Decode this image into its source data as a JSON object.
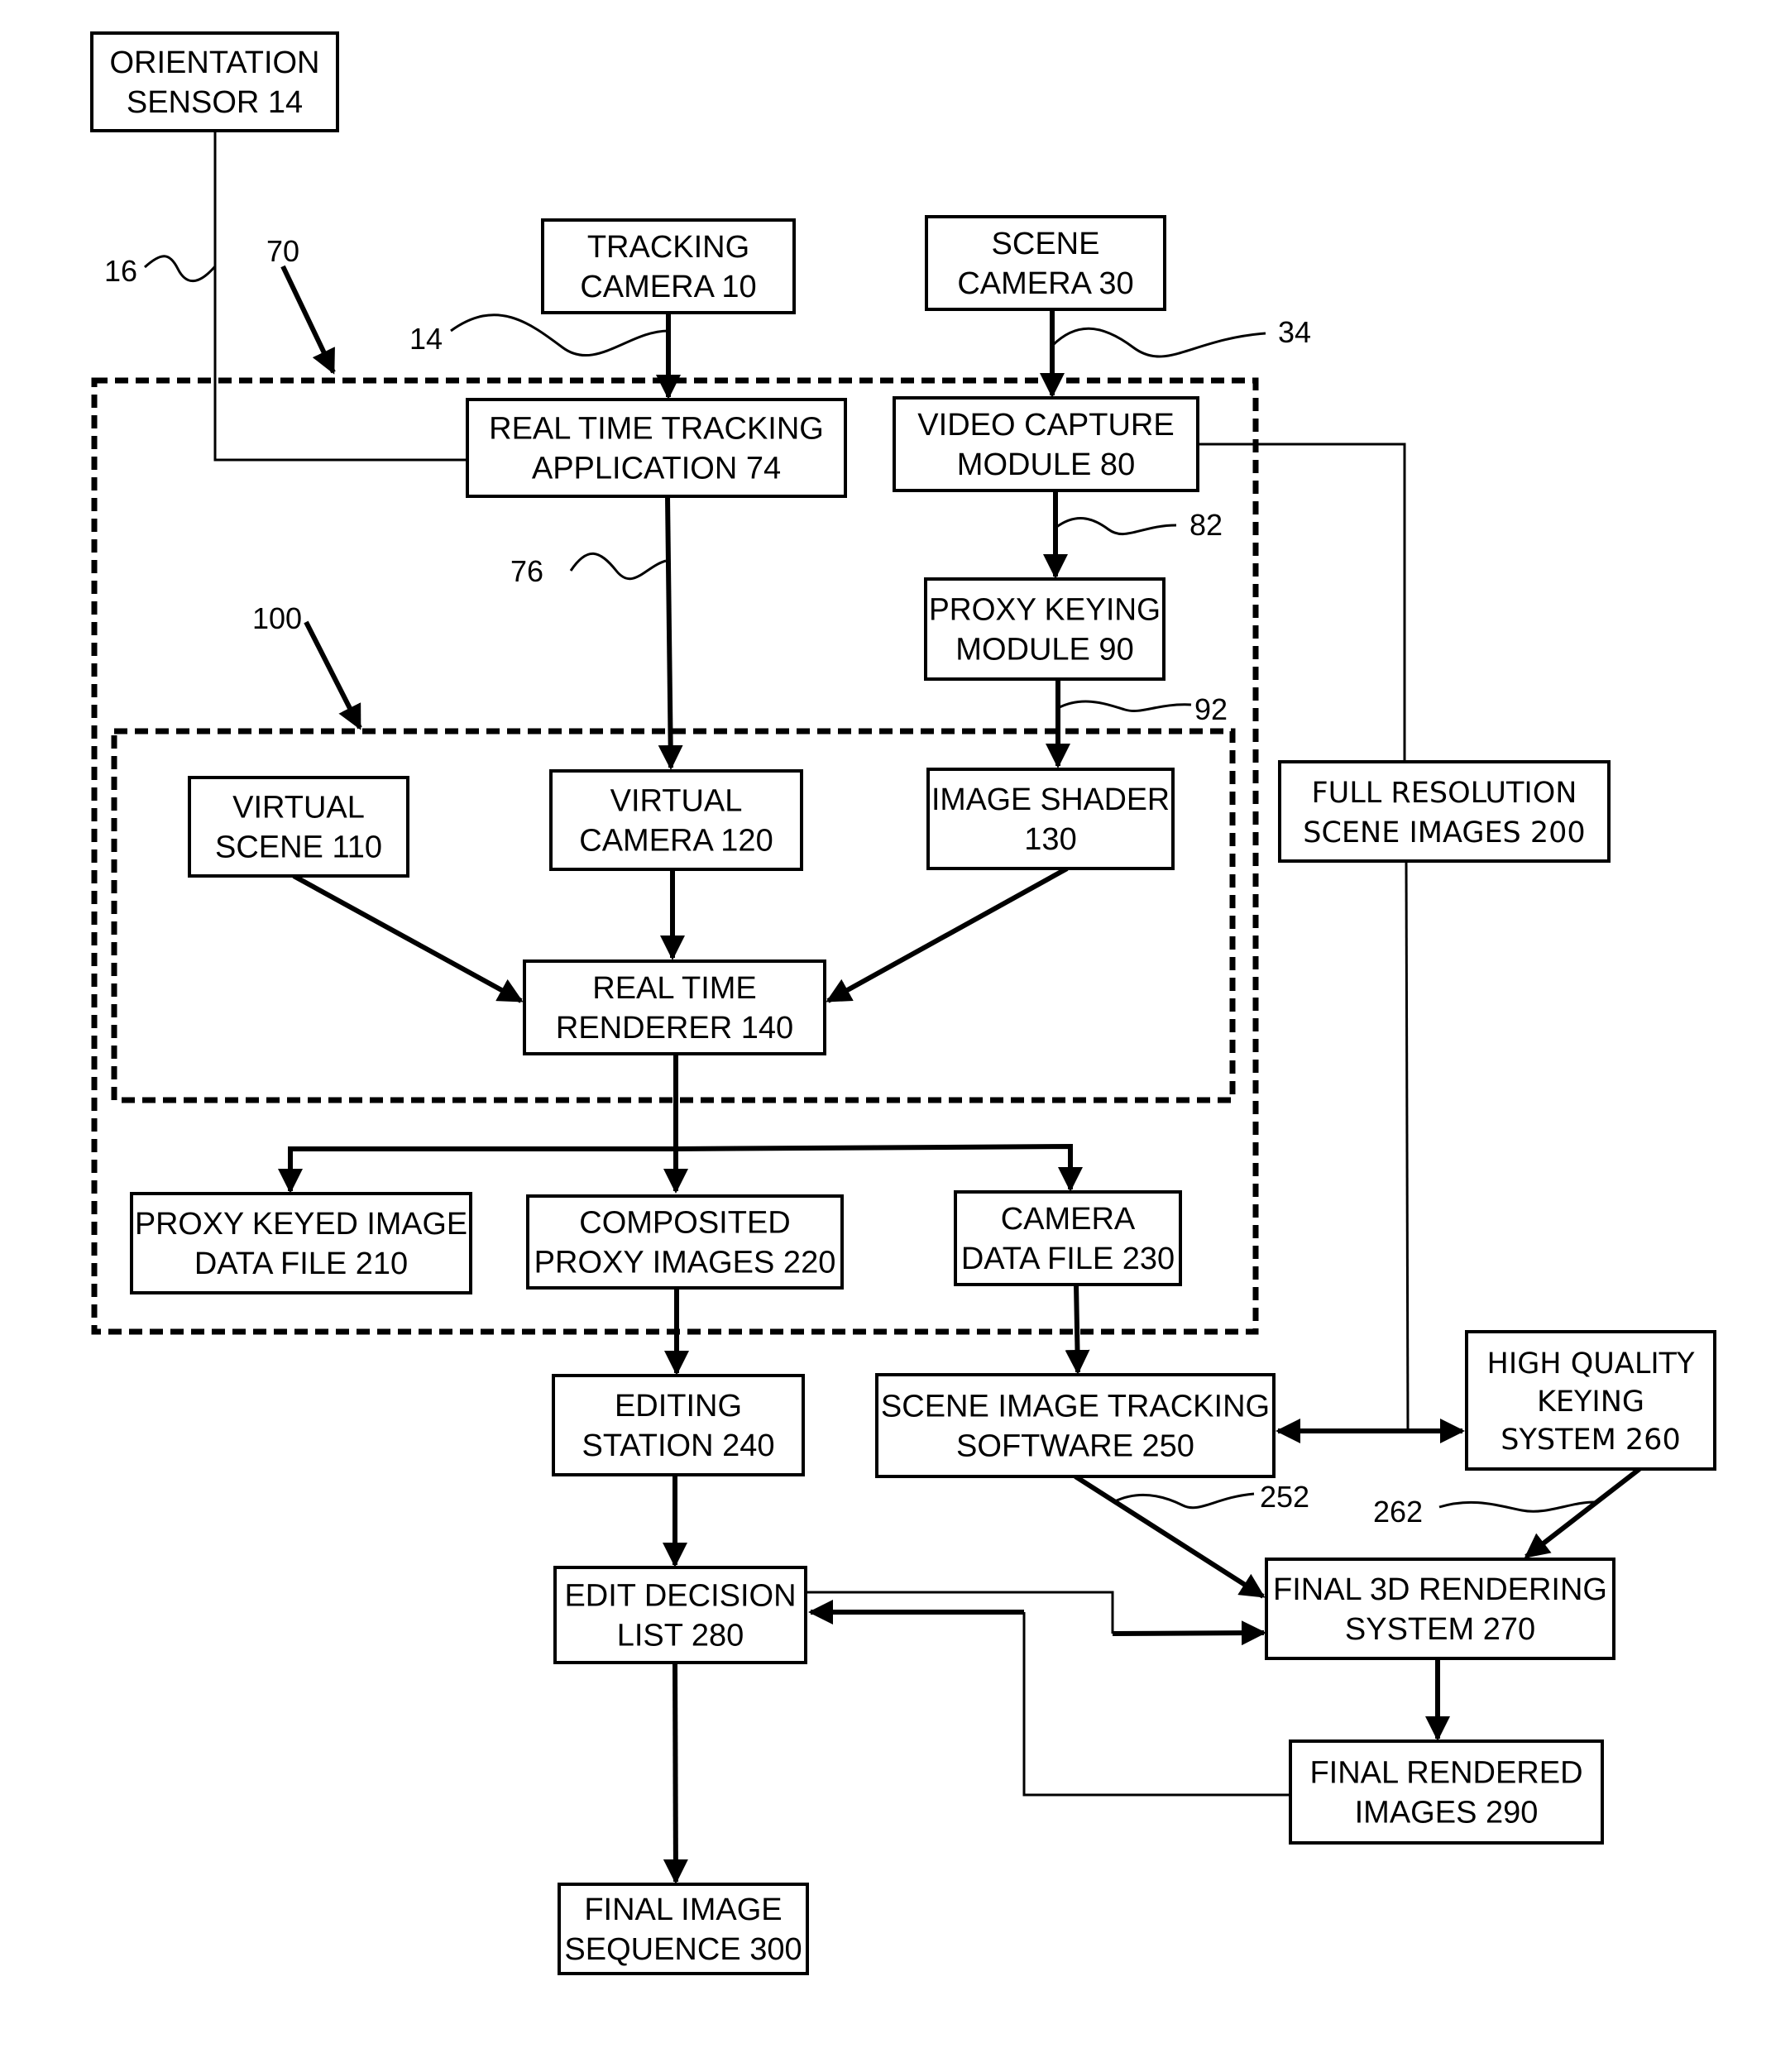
{
  "figure": {
    "type": "block-diagram",
    "description": "Virtual production pipeline flow diagram"
  },
  "boxes": {
    "orientation_sensor": [
      "ORIENTATION",
      "SENSOR 14"
    ],
    "tracking_camera": [
      "TRACKING",
      "CAMERA 10"
    ],
    "scene_camera": [
      "SCENE",
      "CAMERA 30"
    ],
    "real_time_tracking": [
      "REAL TIME TRACKING",
      "APPLICATION 74"
    ],
    "video_capture": [
      "VIDEO CAPTURE",
      "MODULE 80"
    ],
    "proxy_keying": [
      "PROXY KEYING",
      "MODULE 90"
    ],
    "virtual_scene": [
      "VIRTUAL",
      "SCENE 110"
    ],
    "virtual_camera": [
      "VIRTUAL",
      "CAMERA 120"
    ],
    "image_shader": [
      "IMAGE SHADER",
      "130"
    ],
    "real_time_renderer": [
      "REAL TIME",
      "RENDERER 140"
    ],
    "full_resolution": [
      "FULL RESOLUTION",
      "SCENE IMAGES 200"
    ],
    "proxy_keyed_image": [
      "PROXY KEYED IMAGE",
      "DATA FILE 210"
    ],
    "composited_proxy": [
      "COMPOSITED",
      "PROXY IMAGES 220"
    ],
    "camera_data_file": [
      "CAMERA",
      "DATA FILE 230"
    ],
    "editing_station": [
      "EDITING",
      "STATION 240"
    ],
    "scene_image_tracking": [
      "SCENE IMAGE TRACKING",
      "SOFTWARE 250"
    ],
    "high_quality_keying": [
      "HIGH QUALITY",
      "KEYING",
      "SYSTEM 260"
    ],
    "final_3d_rendering": [
      "FINAL 3D RENDERING",
      "SYSTEM 270"
    ],
    "edit_decision_list": [
      "EDIT DECISION",
      "LIST 280"
    ],
    "final_rendered_images": [
      "FINAL RENDERED",
      "IMAGES 290"
    ],
    "final_image_sequence": [
      "FINAL IMAGE",
      "SEQUENCE 300"
    ]
  },
  "refs": {
    "r16": "16",
    "r70": "70",
    "r14": "14",
    "r34": "34",
    "r76": "76",
    "r82": "82",
    "r92": "92",
    "r100": "100",
    "r252": "252",
    "r262": "262"
  }
}
